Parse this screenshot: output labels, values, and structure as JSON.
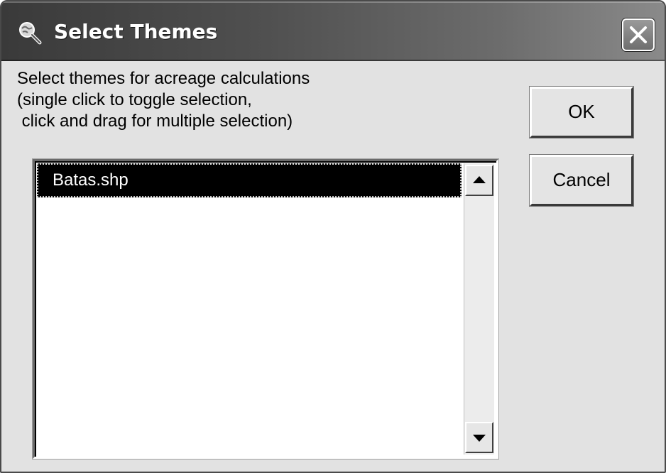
{
  "window": {
    "title": "Select Themes",
    "icon": "magnifier-globe-icon",
    "close_icon": "close-icon"
  },
  "instructions": {
    "line1": "Select themes for acreage calculations",
    "line2": "(single click to toggle selection,",
    "line3": " click and drag for multiple selection)"
  },
  "themes_list": {
    "items": [
      {
        "label": "Batas.shp",
        "selected": true
      }
    ],
    "scroll_up_icon": "arrow-up-icon",
    "scroll_down_icon": "arrow-down-icon"
  },
  "buttons": {
    "ok_label": "OK",
    "cancel_label": "Cancel"
  },
  "colors": {
    "dialog_background": "#e2e2e2",
    "selection_background": "#000000",
    "selection_text": "#ffffff",
    "list_background": "#ffffff"
  }
}
